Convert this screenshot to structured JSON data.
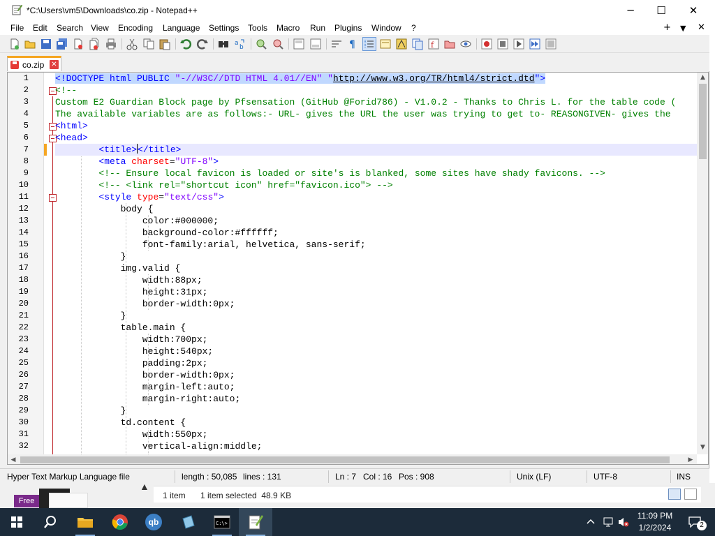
{
  "window": {
    "title": "*C:\\Users\\vm5\\Downloads\\co.zip - Notepad++",
    "controls": {
      "minimize": "─",
      "maximize": "☐",
      "close": "✕"
    }
  },
  "menu": {
    "items": [
      "File",
      "Edit",
      "Search",
      "View",
      "Encoding",
      "Language",
      "Settings",
      "Tools",
      "Macro",
      "Run",
      "Plugins",
      "Window",
      "?"
    ],
    "right": {
      "plus": "+",
      "dropdown": "▼",
      "close": "✕"
    }
  },
  "tab": {
    "label": "co.zip",
    "close": "✕"
  },
  "editor": {
    "current_line": 7,
    "line_numbers": [
      "1",
      "2",
      "3",
      "4",
      "5",
      "6",
      "7",
      "8",
      "9",
      "10",
      "11",
      "12",
      "13",
      "14",
      "15",
      "16",
      "17",
      "18",
      "19",
      "20",
      "21",
      "22",
      "23",
      "24",
      "25",
      "26",
      "27",
      "28",
      "29",
      "30",
      "31",
      "32"
    ],
    "lines": {
      "l1_a": "<!DOCTYPE html PUBLIC ",
      "l1_b": "\"-//W3C//DTD HTML 4.01//EN\"",
      "l1_c": " \"",
      "l1_url": "http://www.w3.org/TR/html4/strict.dtd",
      "l1_d": "\">",
      "l2": "<!--",
      "l3": "Custom E2 Guardian Block page by Pfsensation (GitHub @Forid786) - V1.0.2 - Thanks to Chris L. for the table code (",
      "l4": "The available variables are as follows:- URL- gives the URL the user was trying to get to- REASONGIVEN- gives the",
      "l5": "<html>",
      "l6": "<head>",
      "l7_indent": "        ",
      "l7_open": "<title>",
      "l7_close": "</title>",
      "l8_indent": "        ",
      "l8_tag": "<meta",
      "l8_attr": " charset",
      "l8_eq": "=",
      "l8_val": "\"UTF-8\"",
      "l8_end": ">",
      "l9": "        <!-- Ensure local favicon is loaded or site's is blanked, some sites have shady favicons. -->",
      "l10": "        <!-- <link rel=\"shortcut icon\" href=\"favicon.ico\"> -->",
      "l11_indent": "        ",
      "l11_tag": "<style",
      "l11_attr": " type",
      "l11_eq": "=",
      "l11_val": "\"text/css\"",
      "l11_end": ">",
      "l12": "            body {",
      "l13": "                color:#000000;",
      "l14": "                background-color:#ffffff;",
      "l15": "                font-family:arial, helvetica, sans-serif;",
      "l16": "            }",
      "l17": "            img.valid {",
      "l18": "                width:88px;",
      "l19": "                height:31px;",
      "l20": "                border-width:0px;",
      "l21": "            }",
      "l22": "            table.main {",
      "l23": "                width:700px;",
      "l24": "                height:540px;",
      "l25": "                padding:2px;",
      "l26": "                border-width:0px;",
      "l27": "                margin-left:auto;",
      "l28": "                margin-right:auto;",
      "l29": "            }",
      "l30": "            td.content {",
      "l31": "                width:550px;",
      "l32": "                vertical-align:middle;"
    }
  },
  "status": {
    "file_type": "Hyper Text Markup Language file",
    "length": "length : 50,085",
    "lines": "lines : 131",
    "ln": "Ln : 7",
    "col": "Col : 16",
    "pos": "Pos : 908",
    "eol": "Unix (LF)",
    "encoding": "UTF-8",
    "mode": "INS"
  },
  "background_explorer": {
    "free_badge": "Free",
    "item_count": "1 item",
    "selection": "1 item selected  48.9 KB"
  },
  "taskbar": {
    "time": "11:09 PM",
    "date": "1/2/2024",
    "notification_count": "2",
    "qb_label": "qb"
  },
  "colors": {
    "tag": "#0000ff",
    "attribute": "#ff0000",
    "value": "#8000ff",
    "comment": "#008000",
    "current_line": "#e8e8ff",
    "taskbar": "#1c2b3a"
  }
}
